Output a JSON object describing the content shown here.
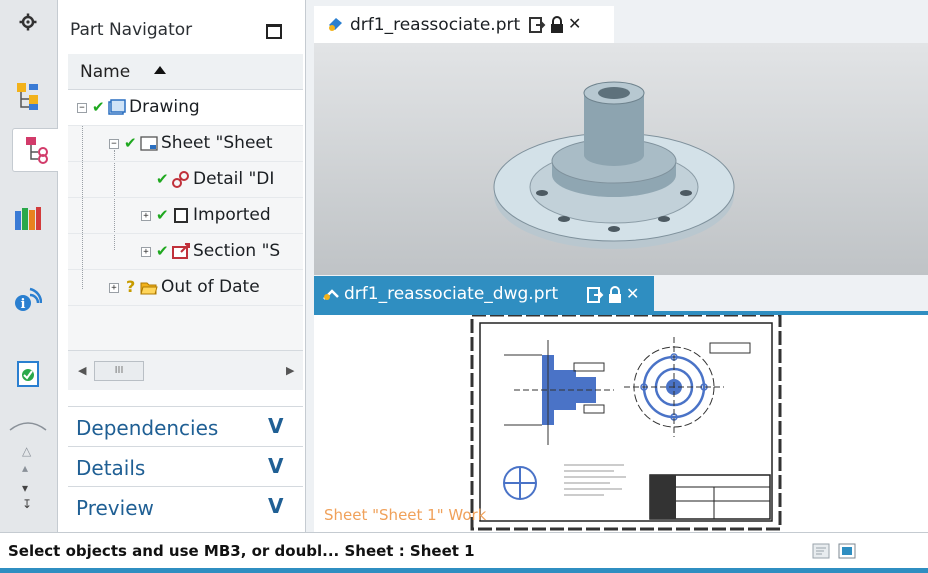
{
  "navigator": {
    "title": "Part Navigator",
    "column_header": "Name",
    "tree": [
      {
        "label": "Drawing",
        "status": "checked",
        "expander": "−"
      },
      {
        "label": "Sheet \"Sheet",
        "status": "checked",
        "expander": "−"
      },
      {
        "label": "Detail \"DI",
        "status": "checked",
        "expander": ""
      },
      {
        "label": "Imported",
        "status": "checked",
        "expander": "+"
      },
      {
        "label": "Section \"S",
        "status": "checked",
        "expander": "+"
      },
      {
        "label": "Out of Date",
        "status": "unknown",
        "expander": "+"
      }
    ],
    "scroll_thumb": "III",
    "sections": [
      {
        "label": "Dependencies"
      },
      {
        "label": "Details"
      },
      {
        "label": "Preview"
      }
    ]
  },
  "tabs": {
    "top": {
      "label": "drf1_reassociate.prt"
    },
    "bottom": {
      "label": "drf1_reassociate_dwg.prt"
    }
  },
  "viewport": {
    "sheet_label": "Sheet \"Sheet 1\" Work"
  },
  "status": {
    "text": "Select objects and use MB3, or doubl... Sheet : Sheet 1"
  },
  "colors": {
    "accent": "#2f8ec1",
    "check": "#1fa81f",
    "section_text": "#1f5f94",
    "sheet_label": "#f0a15a"
  },
  "icons": [
    "settings-icon",
    "assembly-navigator-icon",
    "part-navigator-icon",
    "reuse-library-icon",
    "roles-icon",
    "history-icon",
    "checked-icon",
    "question-icon",
    "folder-icon",
    "lock-icon",
    "close-icon"
  ]
}
